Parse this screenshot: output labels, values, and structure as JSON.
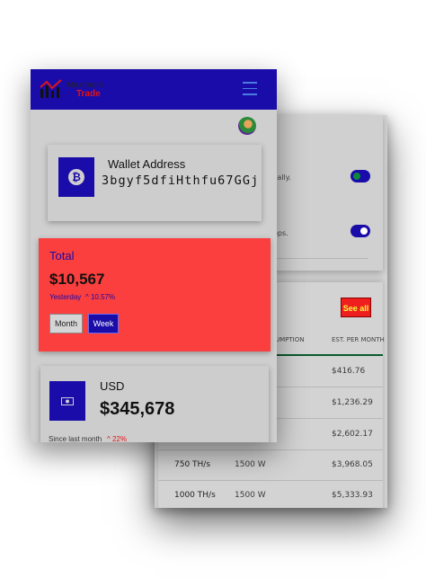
{
  "back_screen": {
    "settings": [
      {
        "text": "cally."
      },
      {
        "text": "ops."
      }
    ],
    "see_all_label": "See all",
    "table": {
      "headers": [
        "UMPTION",
        "EST. PER MONTH"
      ],
      "rows": [
        {
          "hashrate": "",
          "power": "",
          "est": "$416.76"
        },
        {
          "hashrate": "",
          "power": "",
          "est": "$1,236.29"
        },
        {
          "hashrate": "",
          "power": "",
          "est": "$2,602.17"
        },
        {
          "hashrate": "750 TH/s",
          "power": "1500 W",
          "est": "$3,968.05"
        },
        {
          "hashrate": "1000 TH/s",
          "power": "1500 W",
          "est": "$5,333.93"
        }
      ]
    }
  },
  "front_screen": {
    "logo": {
      "line1": "Maximum",
      "line2": "Trade"
    },
    "wallet": {
      "label": "Wallet Address",
      "address": "3bgyf5dfiHthfu67GGj",
      "icon": "bitcoin-icon"
    },
    "total": {
      "label": "Total",
      "value": "$10,567",
      "period": "Yesterday",
      "change": "^ 10.57%",
      "buttons": {
        "month": "Month",
        "week": "Week"
      }
    },
    "usd": {
      "label": "USD",
      "value": "$345,678",
      "period": "Since last month",
      "change": "^ 22%",
      "icon": "cash-icon"
    }
  },
  "colors": {
    "brand": "#1a0ca8",
    "accent_red": "#fb3e3e",
    "positive_green": "#0c8a3a",
    "see_all_bg": "#ef1f1f",
    "see_all_text": "#f4ff3a"
  }
}
